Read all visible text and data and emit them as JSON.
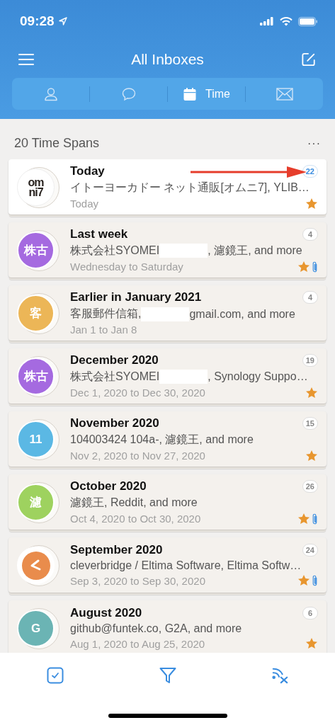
{
  "status_bar": {
    "time": "09:28"
  },
  "header": {
    "title": "All Inboxes"
  },
  "tabs": [
    {
      "kind": "person",
      "selected": false
    },
    {
      "kind": "chat",
      "selected": false
    },
    {
      "kind": "calendar",
      "label": "Time",
      "selected": true
    },
    {
      "kind": "mail",
      "selected": false
    }
  ],
  "section": {
    "title": "20 Time Spans",
    "more": "···"
  },
  "items": [
    {
      "title": "Today",
      "avatar": {
        "kind": "logo",
        "lines": [
          "om",
          "ni7"
        ]
      },
      "senders_before": "イトーヨーカドー ネット通販[オムニ7], YLIB…",
      "redacted": false,
      "date": "Today",
      "count": "22",
      "selected": true,
      "arrow": true,
      "starred": true,
      "attachment": false
    },
    {
      "title": "Last week",
      "avatar": {
        "kind": "initials",
        "text": "株古",
        "color": "#a56ae0"
      },
      "senders_before": "株式会社SYOMEI ",
      "redacted": true,
      "senders_after": ", 濾鏡王, and more",
      "date": "Wednesday to Saturday",
      "count": "4",
      "selected": false,
      "arrow": false,
      "starred": true,
      "attachment": true
    },
    {
      "title": "Earlier in January 2021",
      "avatar": {
        "kind": "initials",
        "text": "客",
        "color": "#ecb657"
      },
      "senders_before": "客服郵件信箱, ",
      "redacted": true,
      "senders_after": "gmail.com, and more",
      "date": "Jan 1 to Jan 8",
      "count": "4",
      "selected": false,
      "arrow": false,
      "starred": false,
      "attachment": false
    },
    {
      "title": "December 2020",
      "avatar": {
        "kind": "initials",
        "text": "株古",
        "color": "#a56ae0"
      },
      "senders_before": "株式会社SYOMEI ",
      "redacted": true,
      "senders_after": ", Synology Suppo…",
      "date": "Dec 1, 2020 to Dec 30, 2020",
      "count": "19",
      "selected": false,
      "arrow": false,
      "starred": true,
      "attachment": false
    },
    {
      "title": "November 2020",
      "avatar": {
        "kind": "initials",
        "text": "11",
        "color": "#5bb8e4"
      },
      "senders_before": "104003424 104a-, 濾鏡王, and more",
      "redacted": false,
      "date": "Nov 2, 2020 to Nov 27, 2020",
      "count": "15",
      "selected": false,
      "arrow": false,
      "starred": true,
      "attachment": false
    },
    {
      "title": "October 2020",
      "avatar": {
        "kind": "initials",
        "text": "濾",
        "color": "#9ed25f"
      },
      "senders_before": "濾鏡王, Reddit, and more",
      "redacted": false,
      "date": "Oct 4, 2020 to Oct 30, 2020",
      "count": "26",
      "selected": false,
      "arrow": false,
      "starred": true,
      "attachment": true
    },
    {
      "title": "September 2020",
      "avatar": {
        "kind": "glyph",
        "color": "#e98c4c"
      },
      "senders_before": "cleverbridge / Eltima Software, Eltima Softw…",
      "redacted": false,
      "date": "Sep 3, 2020 to Sep 30, 2020",
      "count": "24",
      "selected": false,
      "arrow": false,
      "starred": true,
      "attachment": true
    },
    {
      "title": "August 2020",
      "avatar": {
        "kind": "initials",
        "text": "G",
        "color": "#6bb4b4"
      },
      "senders_before": "github@funtek.co, G2A, and more",
      "redacted": false,
      "date": "Aug 1, 2020 to Aug 25, 2020",
      "count": "6",
      "selected": false,
      "arrow": false,
      "starred": true,
      "attachment": false
    }
  ]
}
